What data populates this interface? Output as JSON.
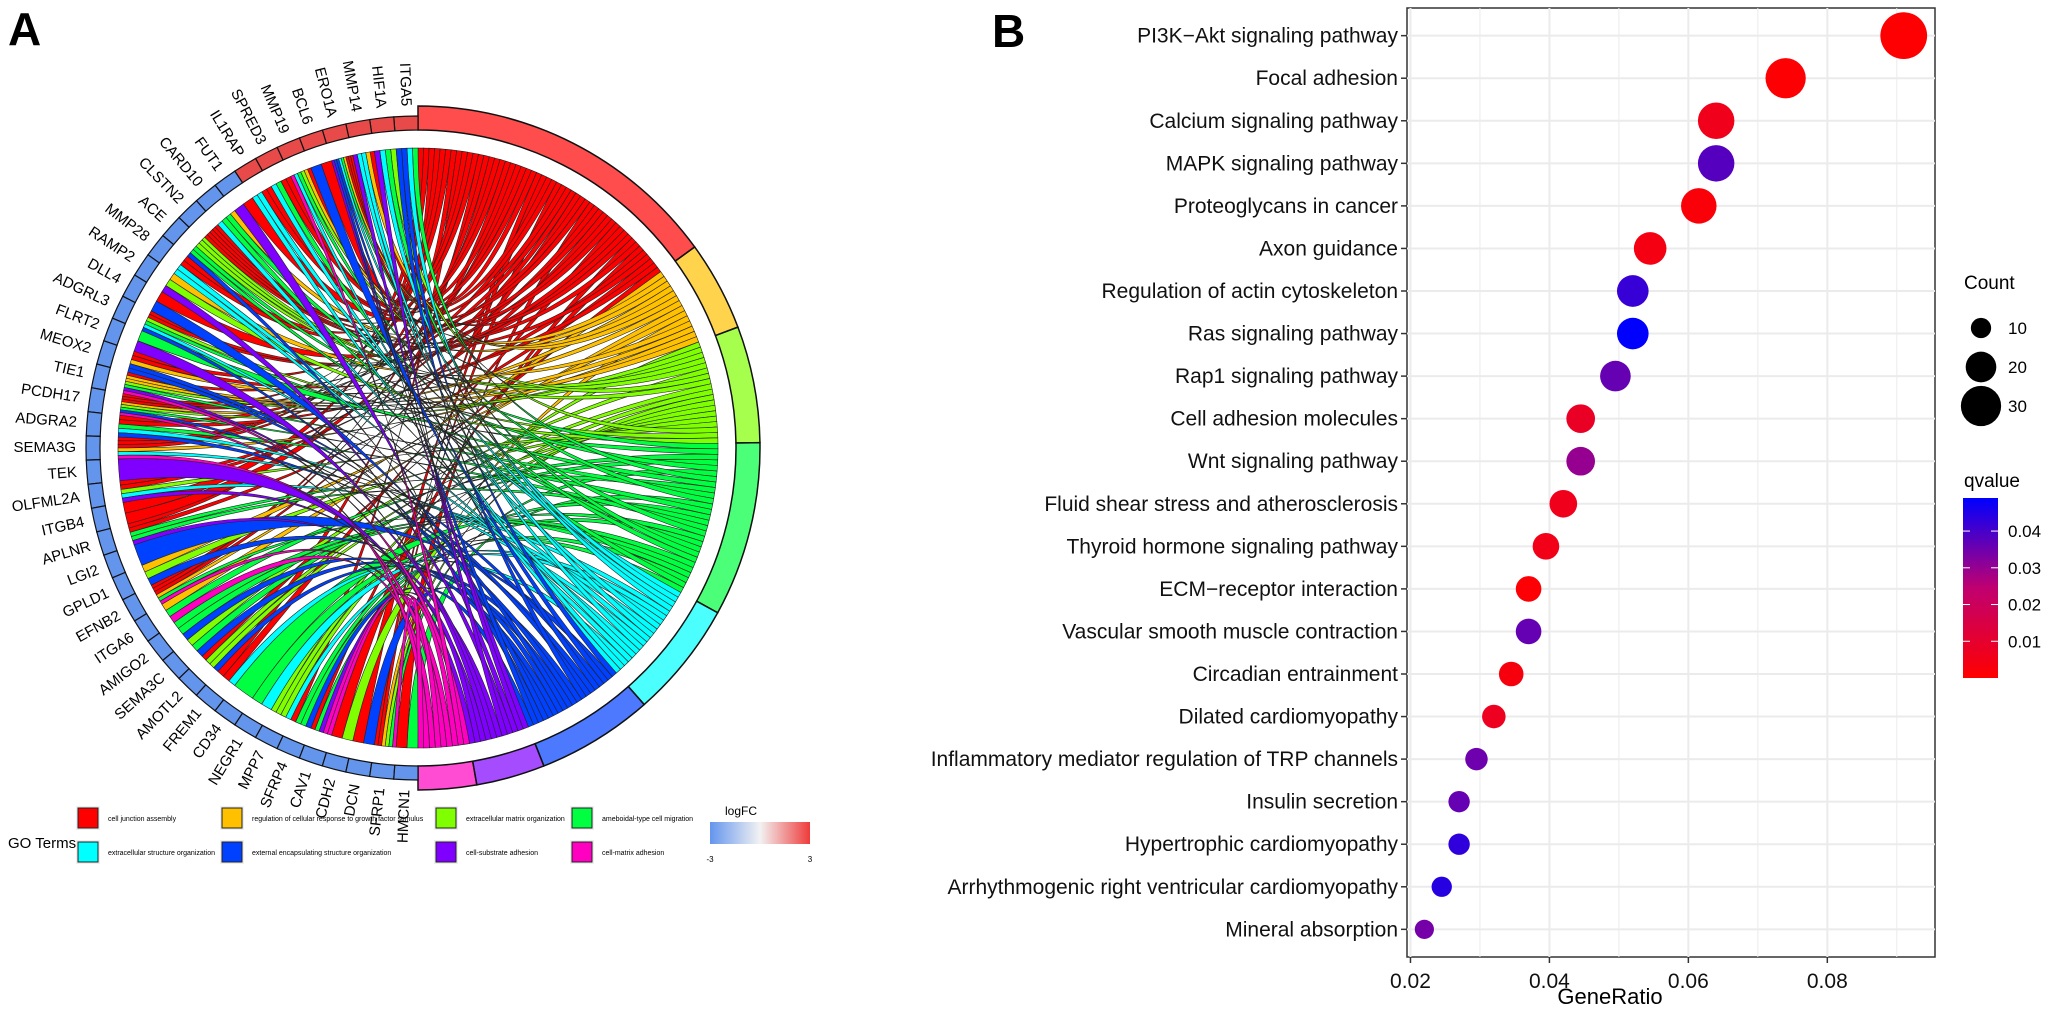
{
  "panelA": {
    "letter": "A",
    "genes": [
      {
        "name": "ITGA5",
        "regulation": "up"
      },
      {
        "name": "HIF1A",
        "regulation": "up"
      },
      {
        "name": "MMP14",
        "regulation": "up"
      },
      {
        "name": "ERO1A",
        "regulation": "up"
      },
      {
        "name": "BCL6",
        "regulation": "up"
      },
      {
        "name": "MMP19",
        "regulation": "up"
      },
      {
        "name": "SPRED3",
        "regulation": "up"
      },
      {
        "name": "IL1RAP",
        "regulation": "up"
      },
      {
        "name": "FUT1",
        "regulation": "down"
      },
      {
        "name": "CARD10",
        "regulation": "down"
      },
      {
        "name": "CLSTN2",
        "regulation": "down"
      },
      {
        "name": "ACE",
        "regulation": "down"
      },
      {
        "name": "MMP28",
        "regulation": "down"
      },
      {
        "name": "RAMP2",
        "regulation": "down"
      },
      {
        "name": "DLL4",
        "regulation": "down"
      },
      {
        "name": "ADGRL3",
        "regulation": "down"
      },
      {
        "name": "FLRT2",
        "regulation": "down"
      },
      {
        "name": "MEOX2",
        "regulation": "down"
      },
      {
        "name": "TIE1",
        "regulation": "down"
      },
      {
        "name": "PCDH17",
        "regulation": "down"
      },
      {
        "name": "ADGRA2",
        "regulation": "down"
      },
      {
        "name": "SEMA3G",
        "regulation": "down"
      },
      {
        "name": "TEK",
        "regulation": "down"
      },
      {
        "name": "OLFML2A",
        "regulation": "down"
      },
      {
        "name": "ITGB4",
        "regulation": "down"
      },
      {
        "name": "APLNR",
        "regulation": "down"
      },
      {
        "name": "LGI2",
        "regulation": "down"
      },
      {
        "name": "GPLD1",
        "regulation": "down"
      },
      {
        "name": "EFNB2",
        "regulation": "down"
      },
      {
        "name": "ITGA6",
        "regulation": "down"
      },
      {
        "name": "AMIGO2",
        "regulation": "down"
      },
      {
        "name": "SEMA3C",
        "regulation": "down"
      },
      {
        "name": "AMOTL2",
        "regulation": "down"
      },
      {
        "name": "FREM1",
        "regulation": "down"
      },
      {
        "name": "CD34",
        "regulation": "down"
      },
      {
        "name": "NEGR1",
        "regulation": "down"
      },
      {
        "name": "MPP7",
        "regulation": "down"
      },
      {
        "name": "SFRP4",
        "regulation": "down"
      },
      {
        "name": "CAV1",
        "regulation": "down"
      },
      {
        "name": "CDH2",
        "regulation": "down"
      },
      {
        "name": "DCN",
        "regulation": "down"
      },
      {
        "name": "SFRP1",
        "regulation": "down"
      },
      {
        "name": "HMCN1",
        "regulation": "down"
      }
    ],
    "go_terms": [
      {
        "name": "cell junction assembly",
        "color": "#ff0000",
        "share": 0.3
      },
      {
        "name": "regulation of cellular response to growth factor stimulus",
        "color": "#ffc000",
        "share": 0.085
      },
      {
        "name": "extracellular matrix organization",
        "color": "#80ff00",
        "share": 0.11
      },
      {
        "name": "ameboidal-type cell migration",
        "color": "#00ff40",
        "share": 0.165
      },
      {
        "name": "extracellular structure organization",
        "color": "#00ffff",
        "share": 0.11
      },
      {
        "name": "external encapsulating structure organization",
        "color": "#0040ff",
        "share": 0.11
      },
      {
        "name": "cell-substrate adhesion",
        "color": "#8000ff",
        "share": 0.065
      },
      {
        "name": "cell-matrix adhesion",
        "color": "#ff00c0",
        "share": 0.055
      }
    ],
    "legend": {
      "title": "GO Terms",
      "logfc_title": "logFC",
      "logfc_min": "-3",
      "logfc_max": "3",
      "up_color": "#e84a4a",
      "down_color": "#6495ed"
    }
  },
  "panelB": {
    "letter": "B"
  },
  "chart_data": {
    "type": "scatter",
    "title": "",
    "xlabel": "GeneRatio",
    "ylabel": "",
    "xlim": [
      0.0195,
      0.0955
    ],
    "xticks": [
      "0.02",
      "0.04",
      "0.06",
      "0.08"
    ],
    "grid": true,
    "categories": [
      "PI3K−Akt signaling pathway",
      "Focal adhesion",
      "Calcium signaling pathway",
      "MAPK signaling pathway",
      "Proteoglycans in cancer",
      "Axon guidance",
      "Regulation of actin cytoskeleton",
      "Ras signaling pathway",
      "Rap1 signaling pathway",
      "Cell adhesion molecules",
      "Wnt signaling pathway",
      "Fluid shear stress and atherosclerosis",
      "Thyroid hormone signaling pathway",
      "ECM−receptor interaction",
      "Vascular smooth muscle contraction",
      "Circadian entrainment",
      "Dilated cardiomyopathy",
      "Inflammatory mediator regulation of TRP channels",
      "Insulin secretion",
      "Hypertrophic cardiomyopathy",
      "Arrhythmogenic right ventricular cardiomyopathy",
      "Mineral absorption"
    ],
    "gene_ratio": [
      0.091,
      0.074,
      0.064,
      0.064,
      0.0615,
      0.0545,
      0.052,
      0.052,
      0.0495,
      0.0445,
      0.0445,
      0.042,
      0.0395,
      0.037,
      0.037,
      0.0345,
      0.032,
      0.0295,
      0.027,
      0.027,
      0.0245,
      0.022
    ],
    "count": [
      37,
      30,
      26,
      26,
      25,
      22,
      21,
      21,
      20,
      18,
      18,
      17,
      16,
      15,
      15,
      14,
      13,
      12,
      11,
      11,
      10,
      9
    ],
    "qvalue": [
      0.0005,
      0.0008,
      0.006,
      0.038,
      0.002,
      0.004,
      0.042,
      0.049,
      0.036,
      0.008,
      0.03,
      0.006,
      0.005,
      0.001,
      0.036,
      0.003,
      0.007,
      0.035,
      0.036,
      0.043,
      0.044,
      0.034
    ],
    "size_legend": {
      "title": "Count",
      "values": [
        10,
        20,
        30
      ]
    },
    "color_legend": {
      "title": "qvalue",
      "range": [
        0.0,
        0.049
      ],
      "ticks": [
        "0.04",
        "0.03",
        "0.02",
        "0.01"
      ],
      "low_color": "#ff0000",
      "high_color": "#0000ff"
    }
  }
}
